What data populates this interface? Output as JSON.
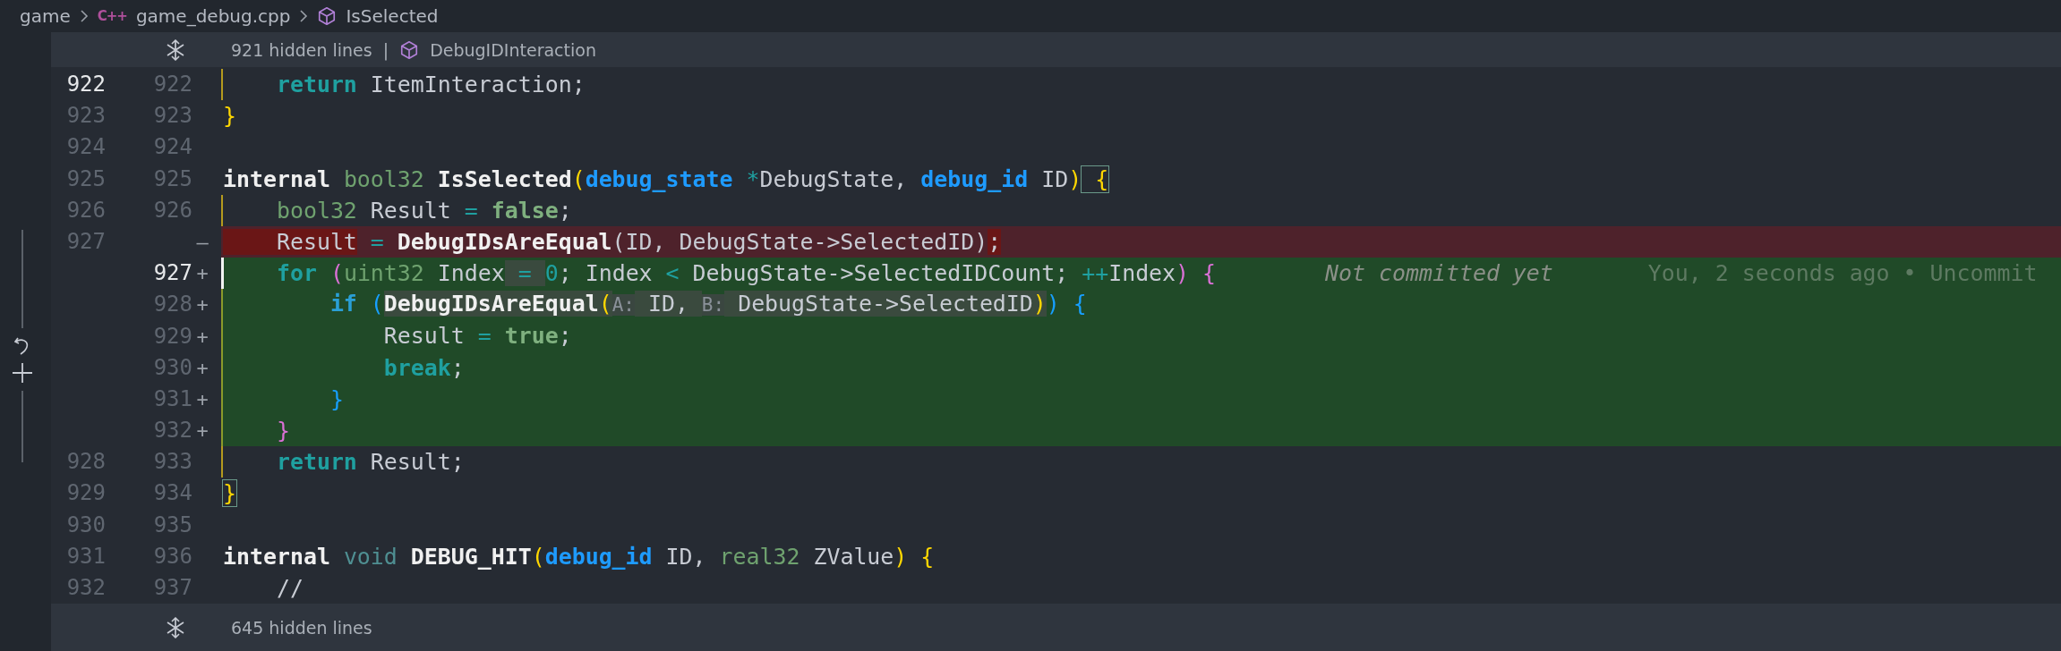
{
  "breadcrumb": [
    {
      "kind": "folder",
      "text": "game"
    },
    {
      "kind": "file",
      "badge": "C++",
      "text": "game_debug.cpp"
    },
    {
      "kind": "symbol",
      "text": "IsSelected"
    }
  ],
  "hidden_top": {
    "text": "921 hidden lines",
    "separator": "|",
    "symbol": "DebugIDInteraction"
  },
  "rows": [
    {
      "old": "922",
      "new": "922",
      "kind": "context",
      "cursor": true,
      "guide": true,
      "code": [
        {
          "text": "    return",
          "kind": "keyword"
        },
        {
          "text": " ItemInteraction;",
          "kind": "plain"
        }
      ]
    },
    {
      "old": "923",
      "new": "923",
      "kind": "context",
      "cursor": false,
      "guide": false,
      "code": [
        {
          "text": "}",
          "kind": "bracket1"
        }
      ]
    },
    {
      "old": "924",
      "new": "924",
      "kind": "context",
      "cursor": false,
      "guide": false
    },
    {
      "old": "925",
      "new": "925",
      "kind": "context",
      "cursor": false,
      "guide": false,
      "code": [
        {
          "text": "internal",
          "kind": "storage"
        },
        {
          "text": " bool32",
          "kind": "type"
        },
        {
          "text": " IsSelected",
          "kind": "function"
        },
        {
          "text": "(",
          "kind": "bracket1"
        },
        {
          "text": "debug_state",
          "kind": "struct"
        },
        {
          "text": " *",
          "kind": "operator"
        },
        {
          "text": "DebugState, ",
          "kind": "plain"
        },
        {
          "text": "debug_id",
          "kind": "struct"
        },
        {
          "text": " ID",
          "kind": "plain"
        },
        {
          "text": ")",
          "kind": "bracket1"
        },
        {
          "text": " {",
          "kind": "bracket1",
          "matched": true
        }
      ]
    },
    {
      "old": "926",
      "new": "926",
      "kind": "context",
      "cursor": false,
      "guide": true,
      "code": [
        {
          "text": "    bool32",
          "kind": "type"
        },
        {
          "text": " Result ",
          "kind": "plain"
        },
        {
          "text": "=",
          "kind": "operator"
        },
        {
          "text": " false",
          "kind": "constant"
        },
        {
          "text": ";",
          "kind": "plain"
        }
      ]
    },
    {
      "old": "927",
      "sign": "—",
      "kind": "deleted",
      "cursor": false,
      "guide": false,
      "code": [
        {
          "text": "    Result",
          "kind": "plain",
          "emph": true
        },
        {
          "text": " =",
          "kind": "operator"
        },
        {
          "text": " DebugIDsAreEqual",
          "kind": "function"
        },
        {
          "text": "(ID, DebugState->SelectedID)",
          "kind": "plain"
        },
        {
          "text": ";",
          "kind": "plain",
          "emph": true
        }
      ]
    },
    {
      "new": "927",
      "sign": "+",
      "kind": "added",
      "cursor": true,
      "guide": true,
      "annotation": "Not committed yet",
      "blame": "You, 2 seconds ago • Uncommit",
      "code": [
        {
          "text": "    for",
          "kind": "keyword"
        },
        {
          "text": " (",
          "kind": "bracket2"
        },
        {
          "text": "uint32",
          "kind": "type"
        },
        {
          "text": " Index",
          "kind": "plain"
        },
        {
          "text": " = ",
          "kind": "operator",
          "emph": true
        },
        {
          "text": "0",
          "kind": "number"
        },
        {
          "text": "; Index ",
          "kind": "plain"
        },
        {
          "text": "<",
          "kind": "operator"
        },
        {
          "text": " DebugState->SelectedIDCount; ",
          "kind": "plain"
        },
        {
          "text": "++",
          "kind": "operator"
        },
        {
          "text": "Index",
          "kind": "plain"
        },
        {
          "text": ")",
          "kind": "bracket2"
        },
        {
          "text": " {",
          "kind": "bracket2"
        }
      ]
    },
    {
      "new": "928",
      "sign": "+",
      "kind": "added",
      "cursor": false,
      "guide": true,
      "code": [
        {
          "text": "        if",
          "kind": "control"
        },
        {
          "text": " (",
          "kind": "bracket3"
        },
        {
          "text": "DebugIDsAreEqual",
          "kind": "function",
          "emph": true
        },
        {
          "text": "(",
          "kind": "bracket1",
          "emph": true
        },
        {
          "text": "A:",
          "kind": "hint"
        },
        {
          "text": " ID, ",
          "kind": "plain",
          "emph": true
        },
        {
          "text": "B:",
          "kind": "hint"
        },
        {
          "text": " DebugState->SelectedID",
          "kind": "plain",
          "emph": true
        },
        {
          "text": ")",
          "kind": "bracket1",
          "emph": true
        },
        {
          "text": ")",
          "kind": "bracket3"
        },
        {
          "text": " {",
          "kind": "bracket3"
        }
      ]
    },
    {
      "new": "929",
      "sign": "+",
      "kind": "added",
      "cursor": false,
      "guide": true,
      "code": [
        {
          "text": "            Result ",
          "kind": "plain"
        },
        {
          "text": "=",
          "kind": "operator"
        },
        {
          "text": " true",
          "kind": "constant"
        },
        {
          "text": ";",
          "kind": "plain"
        }
      ]
    },
    {
      "new": "930",
      "sign": "+",
      "kind": "added",
      "cursor": false,
      "guide": true,
      "code": [
        {
          "text": "            break",
          "kind": "keyword"
        },
        {
          "text": ";",
          "kind": "plain"
        }
      ]
    },
    {
      "new": "931",
      "sign": "+",
      "kind": "added",
      "cursor": false,
      "guide": true,
      "code": [
        {
          "text": "        }",
          "kind": "bracket3"
        }
      ]
    },
    {
      "new": "932",
      "sign": "+",
      "kind": "added",
      "cursor": false,
      "guide": true,
      "code": [
        {
          "text": "    }",
          "kind": "bracket2"
        }
      ]
    },
    {
      "old": "928",
      "new": "933",
      "kind": "context",
      "cursor": false,
      "guide": true,
      "code": [
        {
          "text": "    return",
          "kind": "keyword"
        },
        {
          "text": " Result;",
          "kind": "plain"
        }
      ]
    },
    {
      "old": "929",
      "new": "934",
      "kind": "context",
      "cursor": false,
      "guide": false,
      "code": [
        {
          "text": "}",
          "kind": "bracket1",
          "matched": true
        }
      ]
    },
    {
      "old": "930",
      "new": "935",
      "kind": "context",
      "cursor": false,
      "guide": false
    },
    {
      "old": "931",
      "new": "936",
      "kind": "context",
      "cursor": false,
      "guide": false,
      "code": [
        {
          "text": "internal",
          "kind": "storage"
        },
        {
          "text": " void",
          "kind": "builtin"
        },
        {
          "text": " DEBUG_HIT",
          "kind": "function"
        },
        {
          "text": "(",
          "kind": "bracket1"
        },
        {
          "text": "debug_id",
          "kind": "struct"
        },
        {
          "text": " ID, ",
          "kind": "plain"
        },
        {
          "text": "real32",
          "kind": "type"
        },
        {
          "text": " ZValue",
          "kind": "plain"
        },
        {
          "text": ")",
          "kind": "bracket1"
        },
        {
          "text": " {",
          "kind": "bracket1"
        }
      ]
    },
    {
      "old": "932",
      "new": "937",
      "kind": "context",
      "cursor": false,
      "guide": false,
      "code": [
        {
          "text": "    //",
          "kind": "plain"
        }
      ]
    }
  ],
  "hidden_bottom": {
    "text": "645 hidden lines"
  }
}
